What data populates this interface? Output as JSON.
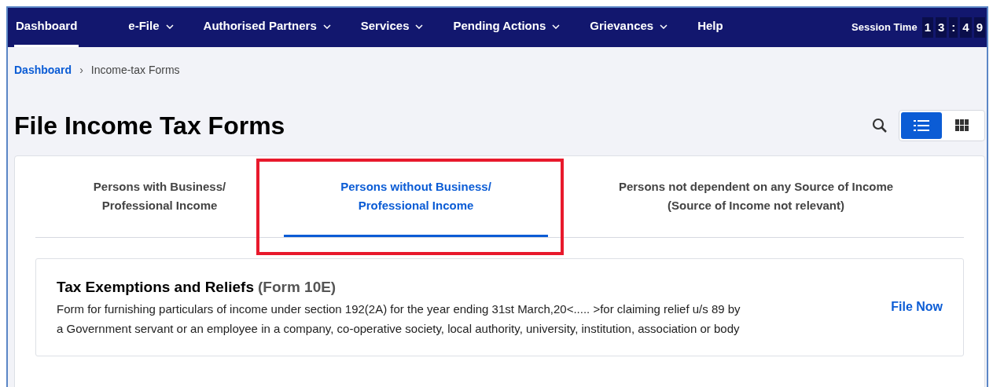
{
  "nav": {
    "items": [
      {
        "label": "Dashboard",
        "selected": true,
        "dropdown": false
      },
      {
        "label": "e-File",
        "selected": false,
        "dropdown": true
      },
      {
        "label": "Authorised Partners",
        "selected": false,
        "dropdown": true
      },
      {
        "label": "Services",
        "selected": false,
        "dropdown": true
      },
      {
        "label": "Pending Actions",
        "selected": false,
        "dropdown": true
      },
      {
        "label": "Grievances",
        "selected": false,
        "dropdown": true
      },
      {
        "label": "Help",
        "selected": false,
        "dropdown": false
      }
    ],
    "session_time": {
      "label": "Session Time",
      "digits": [
        "1",
        "3",
        ":",
        "4",
        "9"
      ]
    }
  },
  "breadcrumb": {
    "separator": "›",
    "items": [
      {
        "label": "Dashboard",
        "link": true
      },
      {
        "label": "Income-tax Forms",
        "link": false
      }
    ]
  },
  "page_title": "File Income Tax Forms",
  "view_toggle": [
    {
      "kind": "list",
      "selected": true
    },
    {
      "kind": "grid",
      "selected": false
    }
  ],
  "tabs": [
    {
      "lines": [
        "Persons with Business/",
        "Professional Income"
      ],
      "selected": false,
      "highlighted": false
    },
    {
      "lines": [
        "Persons without Business/",
        "Professional Income"
      ],
      "selected": true,
      "highlighted": true
    },
    {
      "lines": [
        "Persons not dependent on any Source of Income",
        "(Source of Income not relevant)"
      ],
      "selected": false,
      "highlighted": false
    }
  ],
  "forms": [
    {
      "title": "Tax Exemptions and Reliefs",
      "form_code": "(Form 10E)",
      "description_lines": [
        "Form for furnishing particulars of income under section 192(2A) for the year ending 31st March,20<..... >for claiming relief u/s 89 by",
        "a Government servant or an employee in a company, co-operative society, local authority, university, institution, association or body"
      ],
      "action": "File Now"
    }
  ]
}
